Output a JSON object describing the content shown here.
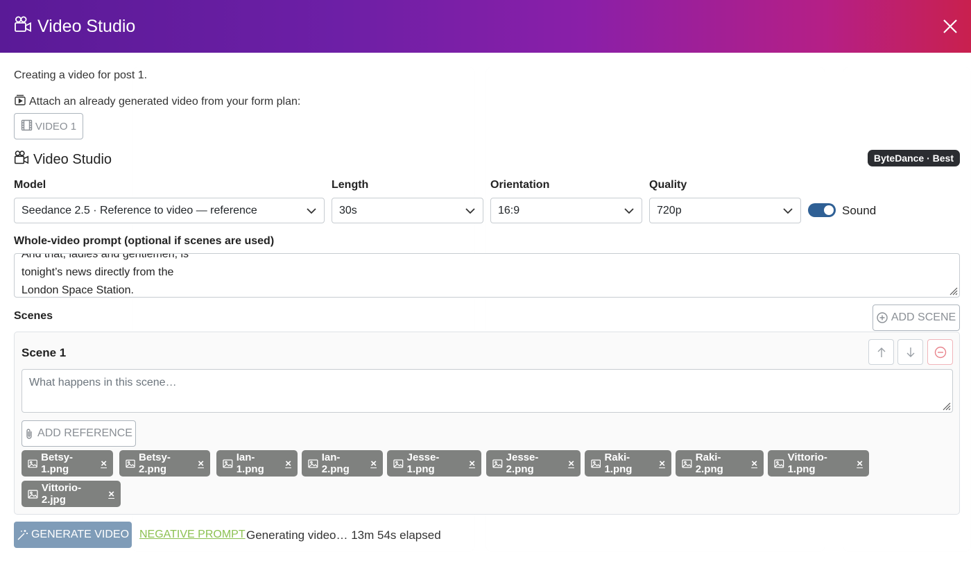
{
  "window": {
    "title": "Video Studio",
    "close_icon": "close-icon"
  },
  "intro": "Creating a video for post 1.",
  "attach": {
    "text": "Attach an already generated video from your form plan:",
    "video_button": "VIDEO 1"
  },
  "studio": {
    "title": "Video Studio",
    "badge": "ByteDance · Best"
  },
  "fields": {
    "model": {
      "label": "Model",
      "value": "Seedance 2.5 · Reference to video — reference"
    },
    "length": {
      "label": "Length",
      "value": "30s"
    },
    "orientation": {
      "label": "Orientation",
      "value": "16:9"
    },
    "quality": {
      "label": "Quality",
      "value": "720p"
    },
    "sound": {
      "label": "Sound",
      "enabled": true
    }
  },
  "prompt": {
    "label_bold": "Whole-video prompt",
    "label_suffix": " (optional if scenes are used)",
    "lines": [
      "And that, ladies and gentlemen, is",
      "tonight’s news directly from the",
      "London Space Station."
    ]
  },
  "scenes": {
    "label": "Scenes",
    "add_button": "ADD SCENE",
    "items": [
      {
        "title": "Scene 1",
        "placeholder": "What happens in this scene…",
        "add_reference": "ADD REFERENCE",
        "references": [
          "Betsy-1.png",
          "Betsy-2.png",
          "Ian-1.png",
          "Ian-2.png",
          "Jesse-1.png",
          "Jesse-2.png",
          "Raki-1.png",
          "Raki-2.png",
          "Vittorio-1.png",
          "Vittorio-2.jpg"
        ]
      }
    ]
  },
  "footer": {
    "generate_button": "GENERATE VIDEO",
    "negative_prompt": "NEGATIVE PROMPT",
    "status": "Generating video… 13m 54s elapsed"
  },
  "colors": {
    "header_gradient_start": "#5a1a97",
    "header_gradient_end": "#c9204e",
    "toggle_on": "#2f6095",
    "generate_button": "#7f9cb8",
    "negative_link": "#8cc152",
    "chip": "#7f817f"
  }
}
